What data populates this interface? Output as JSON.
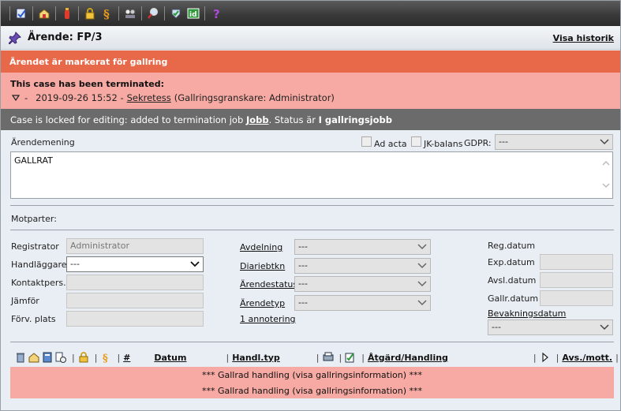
{
  "toolbar": {
    "icons": [
      "edit-document-icon",
      "mailbox-icon",
      "fire-extinguisher-icon",
      "lock-icon",
      "paragraph-icon",
      "people-icon",
      "magnifier-icon",
      "check-shield-icon",
      "id-card-icon",
      "help-icon"
    ]
  },
  "header": {
    "title": "Ärende: FP/3",
    "history_link": "Visa historik"
  },
  "banners": {
    "marked": "Ärendet är markerat för gallring",
    "terminated_title": "This case has been terminated:",
    "terminated_dash": "-",
    "terminated_date": "2019-09-26 15:52 -",
    "terminated_reason": "Sekretess",
    "terminated_detail": "(Gallringsgranskare: Administrator)",
    "locked_prefix": "Case is locked for editing: added to termination job",
    "locked_job": "Jobb",
    "locked_status_prefix": ". Status är",
    "locked_status": "I gallringsjobb"
  },
  "form": {
    "arendemening_label": "Ärendemening",
    "ad_acta_label": "Ad acta",
    "jk_balans_label": "JK-balans",
    "gdpr_label": "GDPR:",
    "gdpr_value": "---",
    "arendemening_value": "GALLRAT",
    "motparter_label": "Motparter:",
    "registrator_label": "Registrator",
    "registrator_value": "Administrator",
    "handlaggare_label": "Handläggare",
    "handlaggare_value": "---",
    "kontaktpers_label": "Kontaktpers.",
    "jamfor_label": "Jämför",
    "forv_plats_label": "Förv. plats",
    "avdelning_label": "Avdelning",
    "avdelning_value": "---",
    "diariebtkn_label": "Diariebtkn",
    "diariebtkn_value": "---",
    "arendestatus_label": "Ärendestatus",
    "arendestatus_value": "---",
    "arendetyp_label": "Ärendetyp",
    "arendetyp_value": "---",
    "annotering_link": "1 annotering",
    "reg_datum_label": "Reg.datum",
    "exp_datum_label": "Exp.datum",
    "avsl_datum_label": "Avsl.datum",
    "gallr_datum_label": "Gallr.datum",
    "bevakningsdatum_label": "Bevakningsdatum",
    "bevakningsdatum_value": "---"
  },
  "grid": {
    "hash": "#",
    "datum": "Datum",
    "handl_typ": "Handl.typ",
    "atgard": "Åtgärd/Handling",
    "avs_mott": "Avs./mott.",
    "rows": [
      "*** Gallrad handling (visa gallringsinformation) ***",
      "*** Gallrad handling (visa gallringsinformation) ***"
    ]
  }
}
